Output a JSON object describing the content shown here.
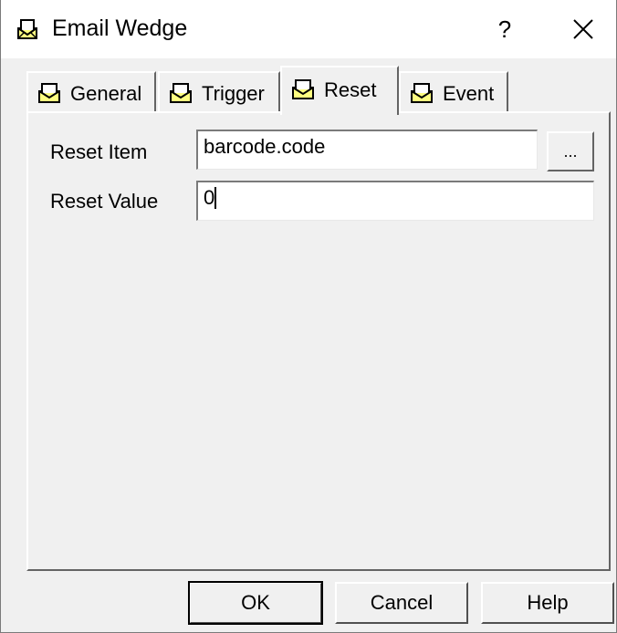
{
  "window": {
    "title": "Email Wedge",
    "help_label": "?",
    "title_icon": "envelope-icon",
    "close_icon": "close-icon"
  },
  "tabs": [
    {
      "label": "General",
      "icon": "envelope-icon",
      "active": false
    },
    {
      "label": "Trigger",
      "icon": "envelope-icon",
      "active": false
    },
    {
      "label": "Reset",
      "icon": "envelope-icon",
      "active": true
    },
    {
      "label": "Event",
      "icon": "envelope-icon",
      "active": false
    }
  ],
  "reset": {
    "item_label": "Reset Item",
    "item_value": "barcode.code",
    "browse_label": "...",
    "value_label": "Reset Value",
    "value_value": "0"
  },
  "buttons": {
    "ok": "OK",
    "cancel": "Cancel",
    "help": "Help"
  },
  "colors": {
    "face": "#f0f0f0",
    "icon_fill": "#ffff80"
  }
}
